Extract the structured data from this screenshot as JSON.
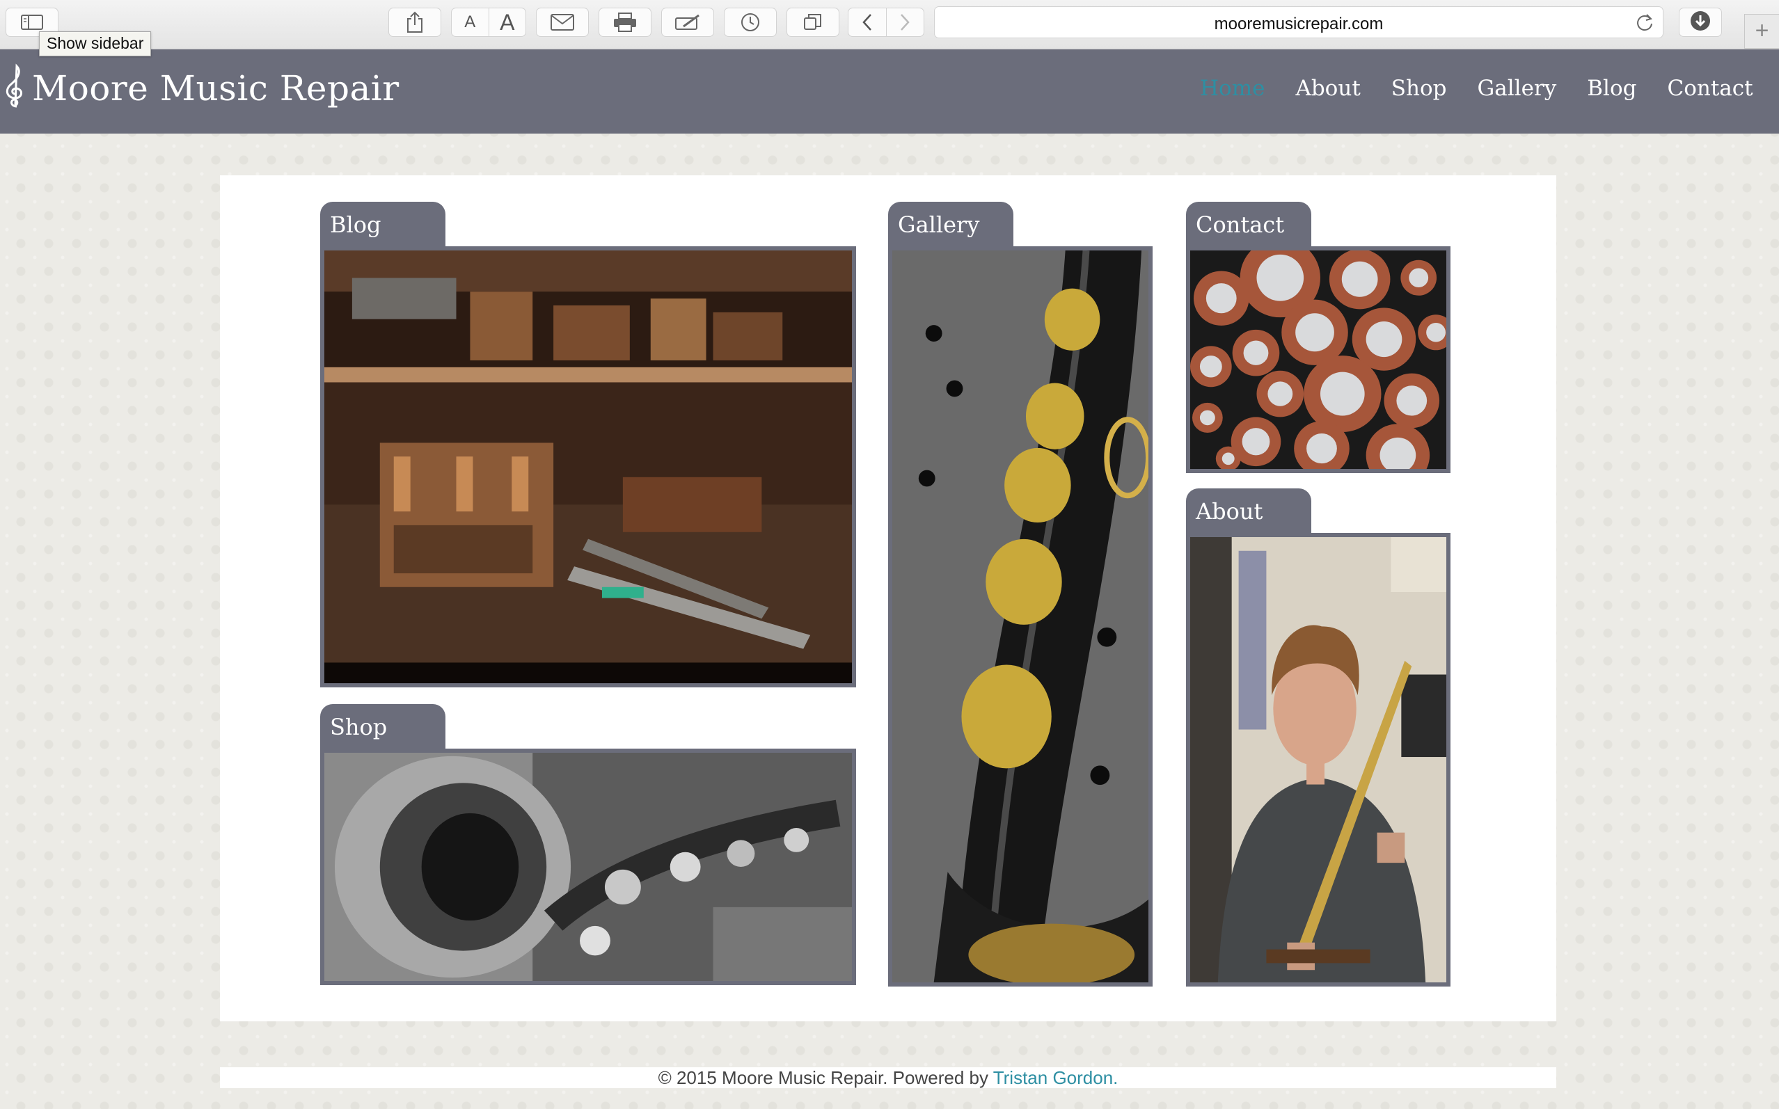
{
  "browser": {
    "url": "mooremusicrepair.com",
    "tooltip": "Show sidebar",
    "font_small_label": "A",
    "font_large_label": "A",
    "new_tab_label": "+"
  },
  "site": {
    "title": "Moore Music Repair",
    "nav": [
      {
        "label": "Home",
        "active": true
      },
      {
        "label": "About",
        "active": false
      },
      {
        "label": "Shop",
        "active": false
      },
      {
        "label": "Gallery",
        "active": false
      },
      {
        "label": "Blog",
        "active": false
      },
      {
        "label": "Contact",
        "active": false
      }
    ],
    "accent_color": "#2e8fa3",
    "header_color": "#6b6d7b"
  },
  "tiles": {
    "blog": {
      "label": "Blog"
    },
    "shop": {
      "label": "Shop"
    },
    "gallery": {
      "label": "Gallery"
    },
    "contact": {
      "label": "Contact"
    },
    "about": {
      "label": "About"
    }
  },
  "footer": {
    "text": "© 2015 Moore Music Repair. Powered by ",
    "link_text": "Tristan Gordon."
  }
}
